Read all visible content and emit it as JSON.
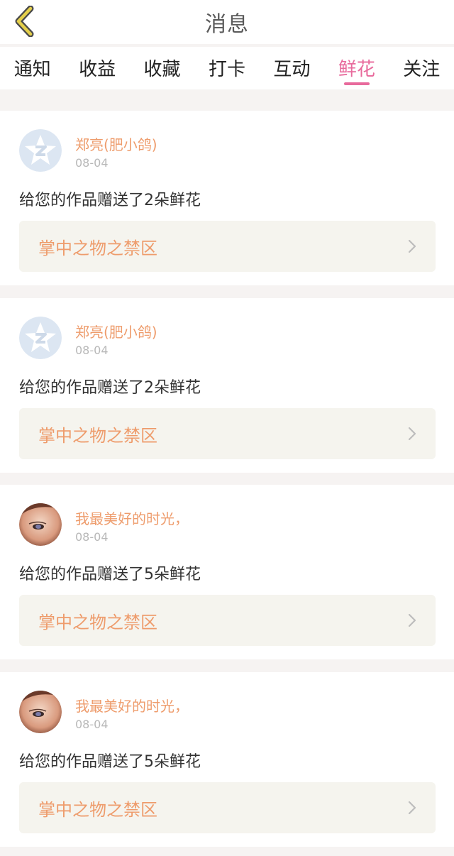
{
  "header": {
    "title": "消息"
  },
  "tabs": [
    {
      "label": "通知",
      "active": false
    },
    {
      "label": "收益",
      "active": false
    },
    {
      "label": "收藏",
      "active": false
    },
    {
      "label": "打卡",
      "active": false
    },
    {
      "label": "互动",
      "active": false
    },
    {
      "label": "鲜花",
      "active": true
    },
    {
      "label": "关注",
      "active": false
    }
  ],
  "messages": [
    {
      "avatar": "qzone-default-avatar",
      "username": "郑亮(肥小鸽)",
      "date": "08-04",
      "text": "给您的作品赠送了2朵鲜花",
      "work_title": "掌中之物之禁区"
    },
    {
      "avatar": "qzone-default-avatar",
      "username": "郑亮(肥小鸽)",
      "date": "08-04",
      "text": "给您的作品赠送了2朵鲜花",
      "work_title": "掌中之物之禁区"
    },
    {
      "avatar": "user-photo-avatar",
      "username": "我最美好的时光，",
      "date": "08-04",
      "text": "给您的作品赠送了5朵鲜花",
      "work_title": "掌中之物之禁区"
    },
    {
      "avatar": "user-photo-avatar",
      "username": "我最美好的时光，",
      "date": "08-04",
      "text": "给您的作品赠送了5朵鲜花",
      "work_title": "掌中之物之禁区"
    }
  ],
  "colors": {
    "accent": "#e86a9c",
    "username": "#ee9c6c",
    "background": "#f6f3f2",
    "link_bg": "#f5f4ee"
  }
}
